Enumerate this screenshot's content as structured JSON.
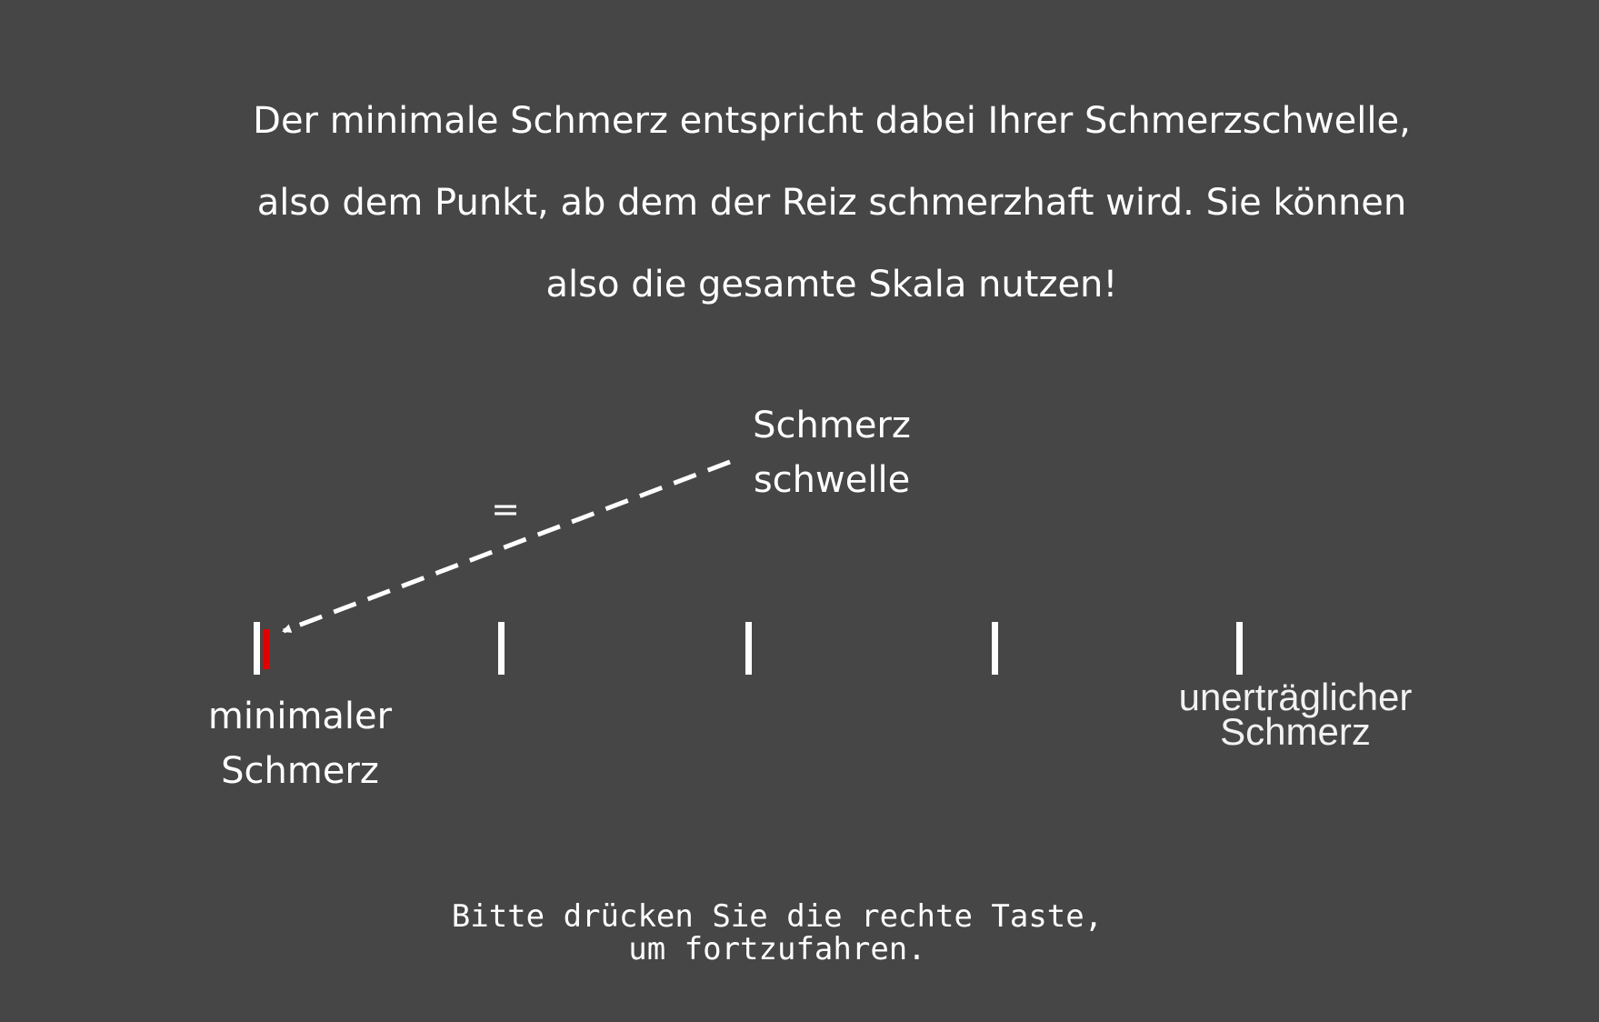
{
  "instruction": {
    "lines": [
      "Der minimale Schmerz entspricht dabei Ihrer Schmerzschwelle,",
      "also dem Punkt, ab dem der Reiz schmerzhaft wird. Sie können",
      "also die gesamte Skala nutzen!"
    ]
  },
  "threshold": {
    "line1": "Schmerz",
    "line2": "schwelle",
    "equals": "="
  },
  "scale": {
    "tick_count": 5,
    "min_label": {
      "line1": "minimaler",
      "line2": "Schmerz"
    },
    "max_label": {
      "line1": "unerträglicher",
      "line2": "Schmerz"
    },
    "marker_color": "#e00000",
    "tick_color": "#ffffff"
  },
  "footer": {
    "line1": "Bitte drücken Sie die rechte Taste,",
    "line2": "um fortzufahren."
  },
  "colors": {
    "background": "#464646",
    "text": "#ffffff"
  }
}
